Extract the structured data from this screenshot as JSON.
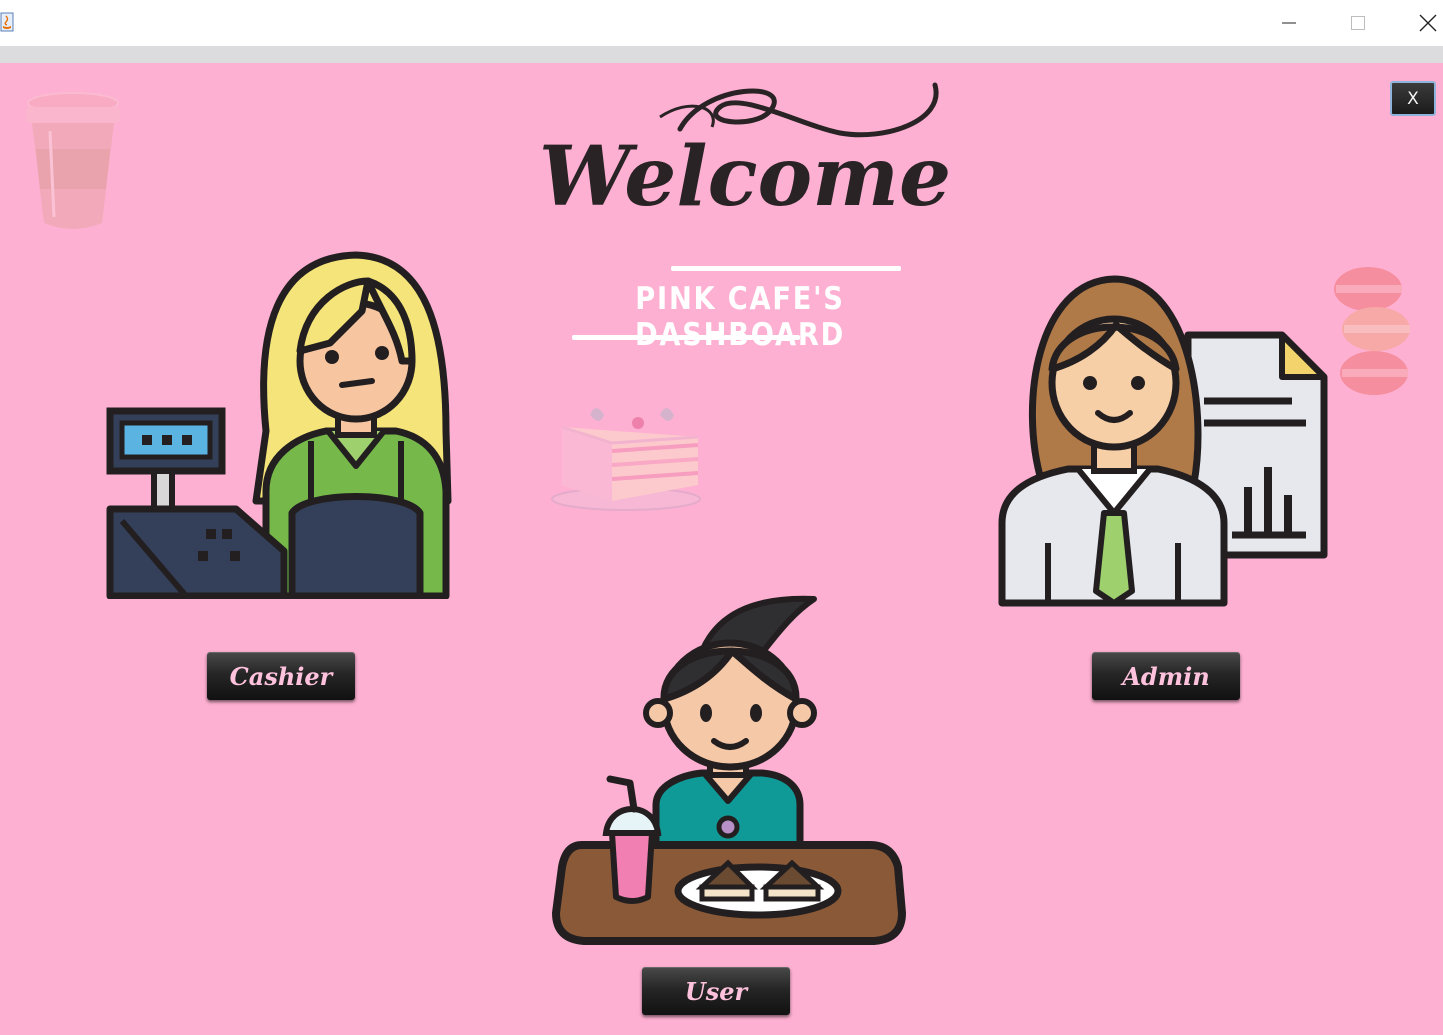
{
  "window": {
    "minimize_glyph": "—",
    "maximize_glyph": "☐",
    "close_glyph": "✕"
  },
  "header": {
    "welcome_text": "Welcome",
    "dashboard_title": "PINK CAFE'S DASHBOARD"
  },
  "close_button": {
    "label": "X"
  },
  "roles": {
    "cashier_label": "Cashier",
    "admin_label": "Admin",
    "user_label": "User"
  },
  "colors": {
    "background": "#feb0d2",
    "button_text": "#ffc2dd",
    "button_bg": "#1f1f1f",
    "title_text": "#ffffff"
  }
}
